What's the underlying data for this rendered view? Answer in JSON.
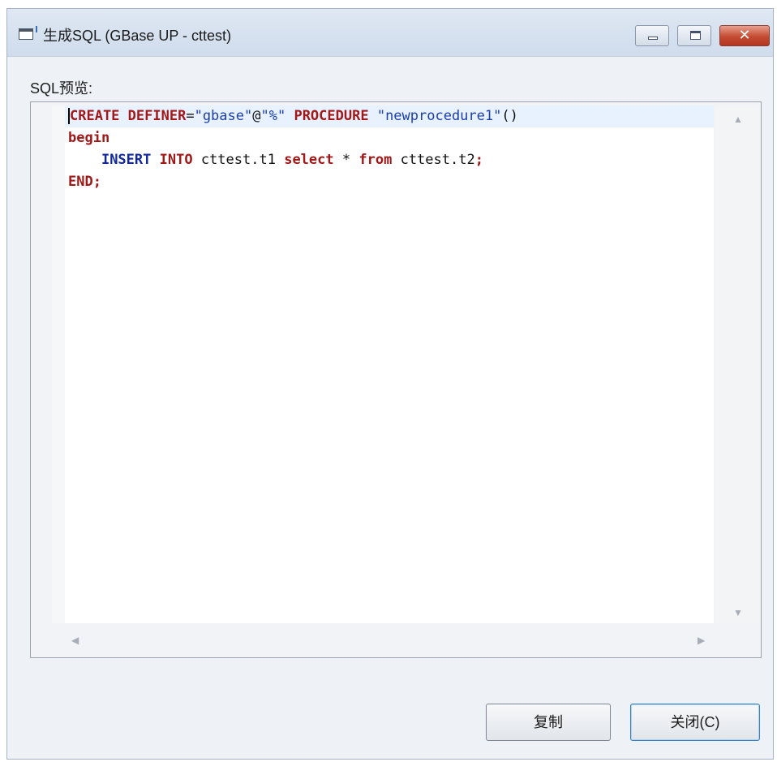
{
  "window": {
    "title": "生成SQL (GBase UP - cttest)",
    "close_glyph": "✕"
  },
  "icons": {
    "app": "app-window-icon",
    "minimize": "minimize-icon",
    "maximize": "maximize-icon",
    "close": "close-icon"
  },
  "editor": {
    "label": "SQL预览:",
    "lines": [
      "CREATE DEFINER=\"gbase\"@\"%\" PROCEDURE \"newprocedure1\"()",
      "begin",
      "    INSERT INTO cttest.t1 select * from cttest.t2;",
      "END;"
    ],
    "tokens": {
      "l1_create": "CREATE",
      "l1_definer": "DEFINER",
      "l1_eq": "=",
      "l1_user": "\"gbase\"",
      "l1_at": "@",
      "l1_host": "\"%\"",
      "l1_procedure": "PROCEDURE",
      "l1_name": "\"newprocedure1\"",
      "l1_paren": "()",
      "l2_begin": "begin",
      "l3_indent": "    ",
      "l3_insert": "INSERT",
      "l3_into": "INTO",
      "l3_t1": "cttest.t1",
      "l3_select": "select",
      "l3_star": "*",
      "l3_from": "from",
      "l3_t2": "cttest.t2",
      "l3_semi": ";",
      "l4_end": "END;"
    },
    "scroll_arrows": {
      "up": "▲",
      "down": "▼",
      "left": "◀",
      "right": "▶"
    }
  },
  "buttons": {
    "copy": "复制",
    "close": "关闭(C)"
  },
  "colors": {
    "keyword_red": "#a01818",
    "keyword_blue": "#12289a",
    "current_line": "#e8f2ff",
    "close_button": "#c44b32"
  }
}
